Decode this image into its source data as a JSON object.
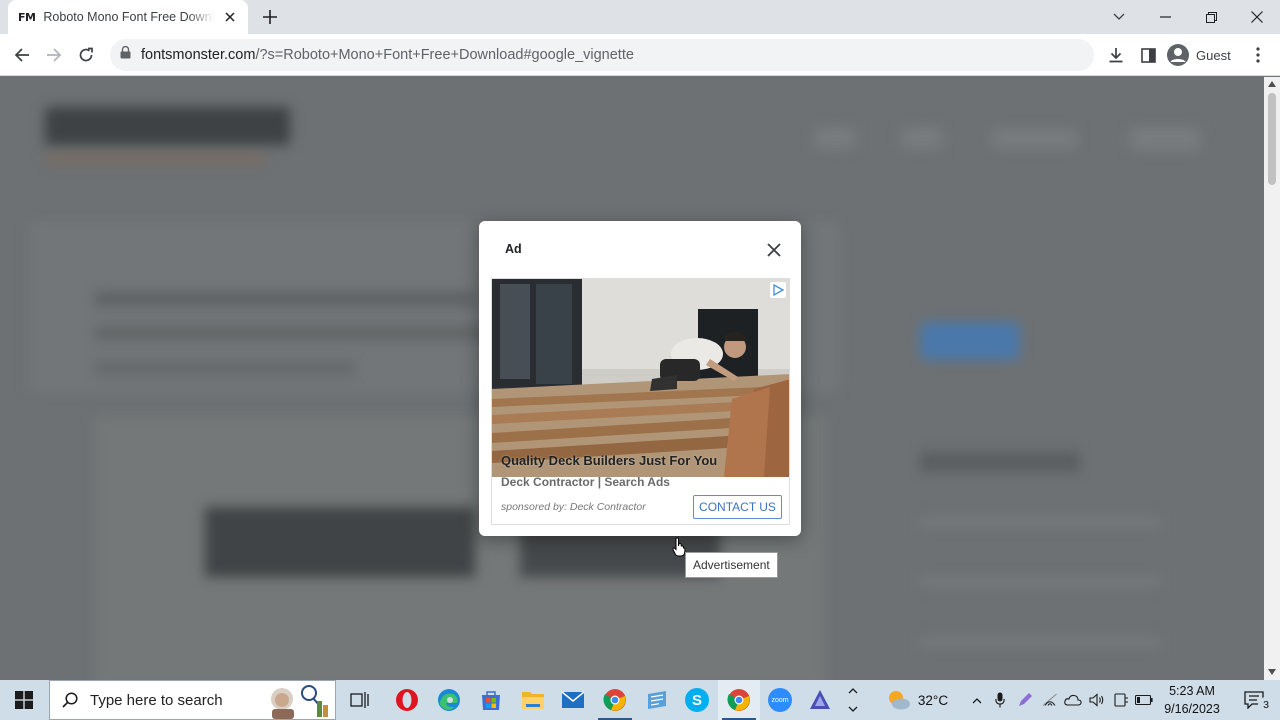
{
  "browser": {
    "tab": {
      "favicon": "FM",
      "title": "Roboto Mono Font Free Download"
    },
    "url": {
      "host": "fontsmonster.com",
      "path": "/?s=Roboto+Mono+Font+Free+Download#google_vignette"
    },
    "profile_label": "Guest"
  },
  "ad": {
    "label": "Ad",
    "headline": "Quality Deck Builders Just For You",
    "subline": "Deck Contractor | Search Ads",
    "sponsor": "sponsored by: Deck Contractor",
    "cta": "CONTACT US",
    "tooltip": "Advertisement"
  },
  "taskbar": {
    "search_placeholder": "Type here to search",
    "temperature": "32°C",
    "time": "5:23 AM",
    "date": "9/16/2023",
    "notification_count": "3",
    "zoom_label": "zoom",
    "skype_label": "S"
  },
  "colors": {
    "overlay": "#6d7173",
    "accent_blue": "#3b73c4",
    "taskbar": "#cfdde8"
  }
}
